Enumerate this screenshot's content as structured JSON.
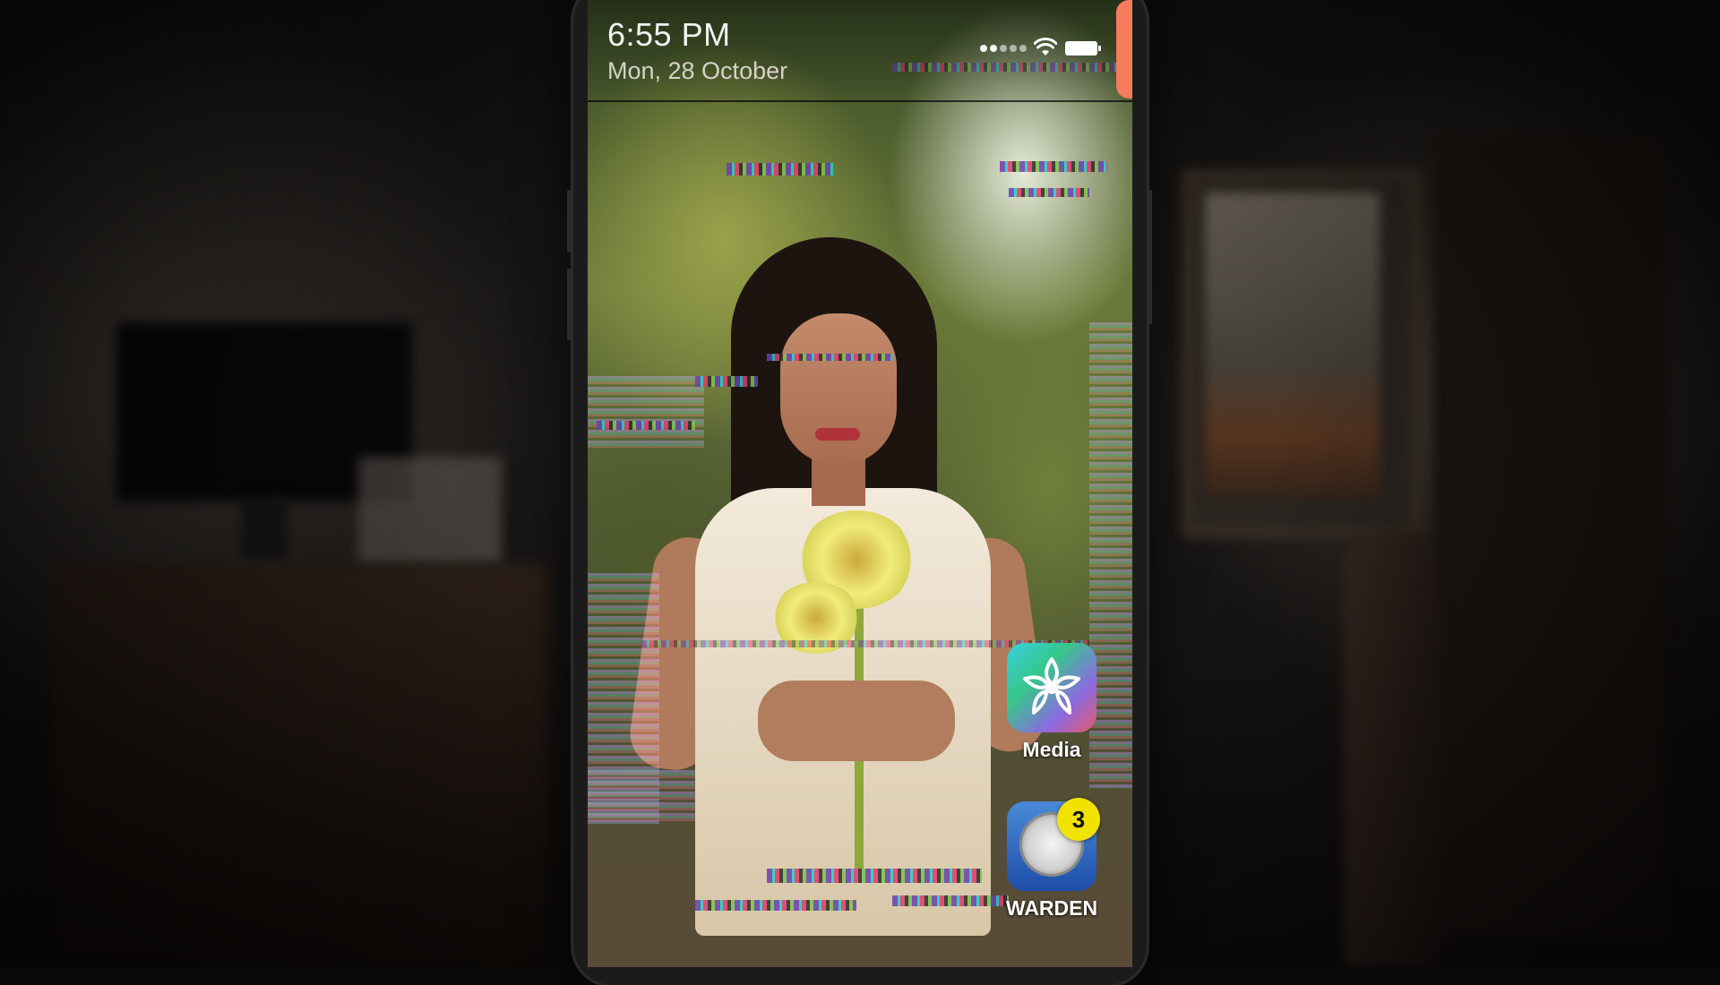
{
  "status_bar": {
    "time": "6:55 PM",
    "date": "Mon, 28 October",
    "icons": [
      "signal-dots-icon",
      "wifi-icon",
      "battery-icon"
    ]
  },
  "home_screen": {
    "wallpaper": "glitched photo of a woman holding yellow flowers",
    "apps": [
      {
        "label": "Media",
        "icon": "media-flower-icon",
        "badge": null
      },
      {
        "label": "WARDEN",
        "icon": "warden-seal-icon",
        "badge": "3"
      }
    ]
  },
  "colors": {
    "notification_tab": "#f47b5c",
    "badge": "#f2e200",
    "media_icon": "#39d0e0",
    "warden_icon": "#2b62c0"
  }
}
